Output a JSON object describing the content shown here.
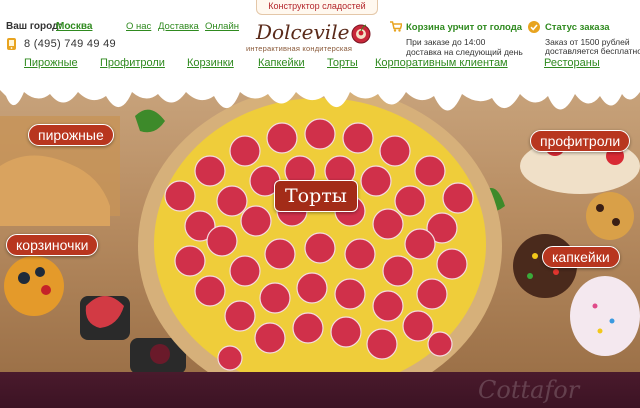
{
  "header": {
    "constructor_link": "Конструктор сладостей",
    "city_label": "Ваш город:",
    "city_value": "Москва",
    "top_links": [
      "О нас",
      "Доставка",
      "Онлайн"
    ],
    "phone": "8 (495) 749 49 49",
    "logo_text": "Dolcevile",
    "logo_subtitle": "интерактивная кондитерская",
    "cart": {
      "title": "Корзина урчит от голода",
      "line1": "При заказе до 14:00",
      "line2": "доставка на следующий день"
    },
    "order_status": {
      "title": "Статус заказа",
      "line1": "Заказ от 1500 рублей",
      "line2": "доставляется бесплатно"
    }
  },
  "main_nav": [
    "Пирожные",
    "Профитроли",
    "Корзинки",
    "Капкейки",
    "Торты",
    "Корпоративным клиентам",
    "Рестораны"
  ],
  "hero": {
    "labels": {
      "pirozhnye": "пирожные",
      "profitroli": "профитроли",
      "torty": "Торты",
      "korzinochki": "корзиночки",
      "kapkeyki": "капкейки"
    }
  },
  "footer": {
    "logo_text": "Cottafor"
  },
  "colors": {
    "nav_green": "#2f8a1f",
    "label_red": "#b8361f",
    "footer_plum": "#4a1a2c"
  }
}
